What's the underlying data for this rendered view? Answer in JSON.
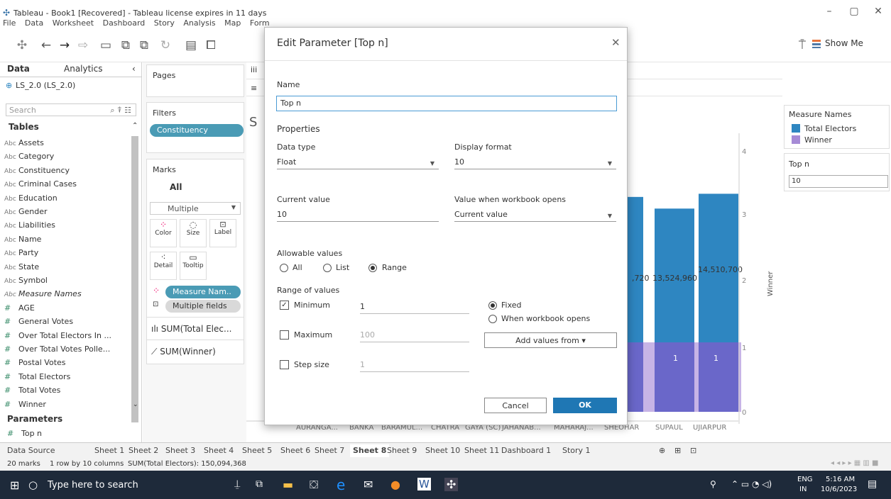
{
  "window": {
    "title": "Tableau - Book1 [Recovered] - Tableau license expires in 11 days"
  },
  "menu": [
    "File",
    "Data",
    "Worksheet",
    "Dashboard",
    "Story",
    "Analysis",
    "Map",
    "Form"
  ],
  "toolbar": {
    "show_me": "Show Me"
  },
  "data_pane": {
    "tab_data": "Data",
    "tab_analytics": "Analytics",
    "datasource": "LS_2.0 (LS_2.0)",
    "search_placeholder": "Search",
    "tables_header": "Tables",
    "dimensions": [
      "Assets",
      "Category",
      "Constituency",
      "Criminal Cases",
      "Education",
      "Gender",
      "Liabilities",
      "Name",
      "Party",
      "State",
      "Symbol",
      "Measure Names"
    ],
    "measures": [
      "AGE",
      "General Votes",
      "Over Total Electors In ...",
      "Over Total Votes Polle...",
      "Postal Votes",
      "Total Electors",
      "Total Votes",
      "Winner"
    ],
    "dim_type": "Abc",
    "measure_type": "#",
    "parameters_header": "Parameters",
    "parameter": "Top n"
  },
  "shelves": {
    "pages": "Pages",
    "filters": "Filters",
    "filter_pill": "Constituency",
    "marks": "Marks",
    "marks_all": "All",
    "mark_type": "Multiple",
    "mark_buttons": [
      "Color",
      "Size",
      "Label",
      "Detail",
      "Tooltip"
    ],
    "measure_names_pill": "Measure Nam..",
    "multiple_fields_pill": "Multiple fields",
    "sum_total": "SUM(Total Elec...",
    "sum_winner": "SUM(Winner)"
  },
  "canvas": {
    "sheet_title_partial": "S",
    "shelf_columns_partial": "iii",
    "shelf_rows_partial": "≡",
    "x_labels": [
      "AURANGA...",
      "BANKA",
      "BARAMUL...",
      "CHATRA",
      "GAYA (SC)",
      "JAHANAB...",
      "MAHARAJ...",
      "SHEOHAR",
      "SUPAUL",
      "UJIARPUR"
    ],
    "right_axis_ticks": [
      "4",
      "3",
      "2",
      "1",
      "0"
    ],
    "right_axis_title": "Winner",
    "bar_labels": [
      ",720",
      "13,524,960",
      "14,510,700"
    ],
    "winner_labels": [
      "1",
      "1"
    ]
  },
  "chart_data": {
    "type": "bar",
    "categories": [
      "SHEOHAR",
      "SUPAUL",
      "UJIARPUR"
    ],
    "series": [
      {
        "name": "Total Electors",
        "values": [
          null,
          13524960,
          14510700
        ]
      },
      {
        "name": "Winner",
        "values": [
          1,
          1,
          1
        ]
      }
    ],
    "ylabel": "Winner",
    "ylim": [
      0,
      4
    ]
  },
  "legend": {
    "title": "Measure Names",
    "items": [
      {
        "label": "Total Electors",
        "color": "#2e86c1"
      },
      {
        "label": "Winner",
        "color": "#a68bd6"
      }
    ],
    "topn_title": "Top n",
    "topn_value": "10"
  },
  "dialog": {
    "title": "Edit Parameter [Top n]",
    "name_label": "Name",
    "name_value": "Top n",
    "properties": "Properties",
    "data_type_label": "Data type",
    "data_type_value": "Float",
    "display_format_label": "Display format",
    "display_format_value": "10",
    "current_value_label": "Current value",
    "current_value": "10",
    "wb_open_label": "Value when workbook opens",
    "wb_open_value": "Current value",
    "allowable_label": "Allowable values",
    "opt_all": "All",
    "opt_list": "List",
    "opt_range": "Range",
    "range_label": "Range of values",
    "minimum_label": "Minimum",
    "minimum_value": "1",
    "maximum_label": "Maximum",
    "maximum_value": "100",
    "step_label": "Step size",
    "step_value": "1",
    "fixed": "Fixed",
    "when_opens": "When workbook opens",
    "add_values": "Add values from ▾",
    "cancel": "Cancel",
    "ok": "OK"
  },
  "sheet_tabs": [
    "Data Source",
    "Sheet 1",
    "Sheet 2",
    "Sheet 3",
    "Sheet 4",
    "Sheet 5",
    "Sheet 6",
    "Sheet 7",
    "Sheet 8",
    "Sheet 9",
    "Sheet 10",
    "Sheet 11",
    "Dashboard 1",
    "Story 1"
  ],
  "status": {
    "marks": "20 marks",
    "layout": "1 row by 10 columns",
    "sum": "SUM(Total Electors): 150,094,368"
  },
  "taskbar": {
    "search": "Type here to search",
    "lang": "ENG",
    "region": "IN",
    "time": "5:16 AM",
    "date": "10/6/2023"
  },
  "colors": {
    "accent": "#4a9bb5",
    "bar_blue": "#2e86c1",
    "bar_purple": "#a68bd6",
    "ok_button": "#1f77b4"
  }
}
